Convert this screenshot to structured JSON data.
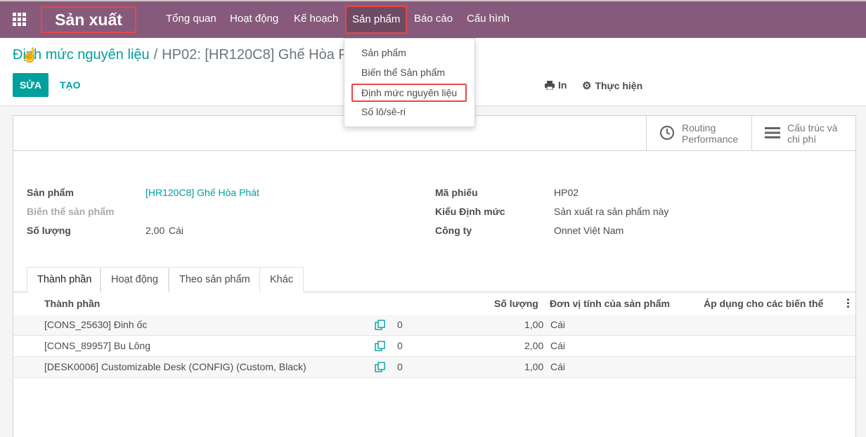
{
  "navbar": {
    "brand": "Sản xuất",
    "menu": [
      "Tổng quan",
      "Hoạt động",
      "Kế hoạch",
      "Sản phẩm",
      "Báo cáo",
      "Cấu hình"
    ],
    "active_index": 3,
    "color": "#875a7b"
  },
  "dropdown": {
    "items": [
      "Sản phẩm",
      "Biến thể Sản phẩm",
      "Định mức nguyên liệu",
      "Số lô/sê-ri"
    ],
    "highlighted_index": 2
  },
  "breadcrumb": {
    "parent": "Định mức nguyên liệu",
    "current": "HP02: [HR120C8] Ghế Hòa Phát"
  },
  "controls": {
    "edit": "SỬA",
    "create": "TẠO",
    "print": "In",
    "action": "Thực hiện"
  },
  "smart_buttons": {
    "routing": [
      "Routing",
      "Performance"
    ],
    "structure": [
      "Cấu trúc và",
      "chi phí"
    ]
  },
  "form": {
    "product_label": "Sản phẩm",
    "product_value": "[HR120C8] Ghế Hòa Phát",
    "variant_label": "Biến thể sản phẩm",
    "qty_label": "Số lượng",
    "qty_value": "2,00",
    "qty_uom": "Cái",
    "ref_label": "Mã phiếu",
    "ref_value": "HP02",
    "type_label": "Kiểu Định mức",
    "type_value": "Sản xuất ra sản phẩm này",
    "company_label": "Công ty",
    "company_value": "Onnet Việt Nam"
  },
  "tabs": [
    "Thành phần",
    "Hoạt động",
    "Theo sản phẩm",
    "Khác"
  ],
  "table": {
    "headers": [
      "Thành phần",
      "Số lượng",
      "Đơn vị tính của sản phẩm",
      "Áp dụng cho các biến thể"
    ],
    "rows": [
      {
        "component": "[CONS_25630] Đinh ốc",
        "count": "0",
        "qty": "1,00",
        "uom": "Cái"
      },
      {
        "component": "[CONS_89957] Bu Lông",
        "count": "0",
        "qty": "2,00",
        "uom": "Cái"
      },
      {
        "component": "[DESK0006] Customizable Desk (CONFIG) (Custom, Black)",
        "count": "0",
        "qty": "1,00",
        "uom": "Cái"
      }
    ]
  },
  "colors": {
    "accent": "#00a09d",
    "highlight_border": "#e54747"
  }
}
